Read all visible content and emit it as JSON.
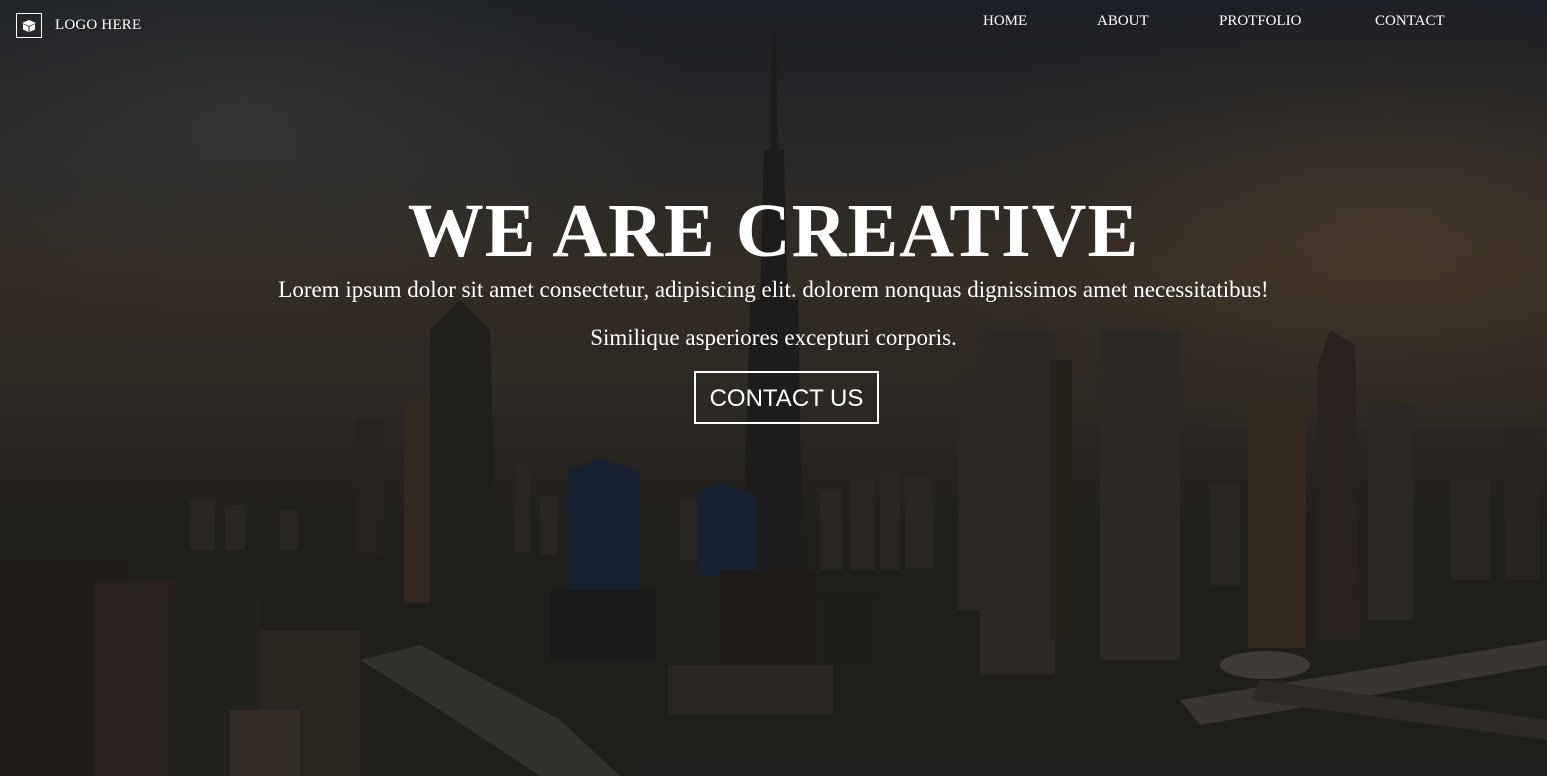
{
  "navbar": {
    "logo_icon": "box-icon",
    "logo_text": "LOGO HERE",
    "links": [
      {
        "label": "HOME"
      },
      {
        "label": "ABOUT"
      },
      {
        "label": "PROTFOLIO"
      },
      {
        "label": "CONTACT"
      }
    ]
  },
  "hero": {
    "background": "city-skyline-photo",
    "headline": "WE ARE CREATIVE",
    "tagline_1": "Lorem ipsum dolor sit amet consectetur, adipisicing elit. dolorem nonquas dignissimos amet necessitatibus!",
    "tagline_2": "Similique asperiores excepturi corporis.",
    "cta_label": "CONTACT US"
  },
  "colors": {
    "text": "#ffffff",
    "overlay": "#000000"
  }
}
